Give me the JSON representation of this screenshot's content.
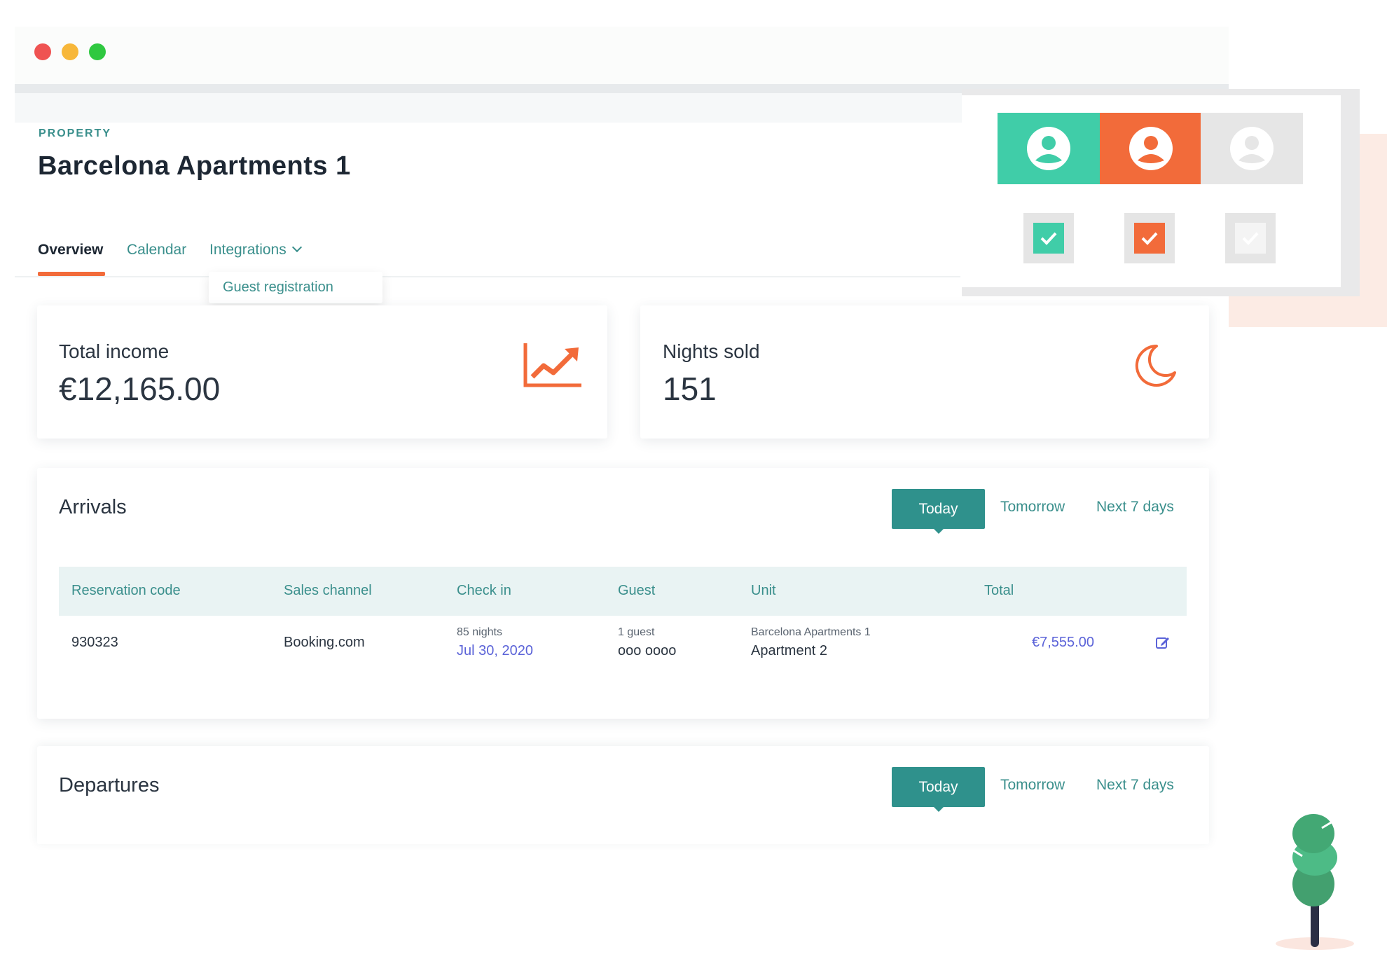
{
  "window": {
    "controls": [
      "close",
      "minimize",
      "maximize"
    ]
  },
  "header": {
    "kicker": "PROPERTY",
    "title": "Barcelona Apartments 1"
  },
  "tabs": [
    {
      "label": "Overview",
      "active": true
    },
    {
      "label": "Calendar"
    },
    {
      "label": "Integrations"
    }
  ],
  "dropdown": {
    "item": "Guest registration"
  },
  "stats": {
    "income": {
      "label": "Total income",
      "value": "€12,165.00",
      "icon": "trending-up-icon"
    },
    "nights": {
      "label": "Nights sold",
      "value": "151",
      "icon": "moon-icon"
    }
  },
  "arrivals": {
    "title": "Arrivals",
    "filters": [
      "Today",
      "Tomorrow",
      "Next 7 days"
    ],
    "columns": [
      "Reservation code",
      "Sales channel",
      "Check in",
      "Guest",
      "Unit",
      "Total"
    ],
    "rows": [
      {
        "code": "930323",
        "channel": "Booking.com",
        "nights": "85 nights",
        "checkin": "Jul 30, 2020",
        "guests": "1 guest",
        "guest_name": "ooo oooo",
        "property": "Barcelona Apartments 1",
        "unit": "Apartment 2",
        "total": "€7,555.00"
      }
    ]
  },
  "departures": {
    "title": "Departures",
    "filters": [
      "Today",
      "Tomorrow",
      "Next 7 days"
    ]
  },
  "colors": {
    "accent": "#f26b3a",
    "teal": "#2f918c",
    "green": "#40cda8",
    "link": "#5b63d8"
  }
}
